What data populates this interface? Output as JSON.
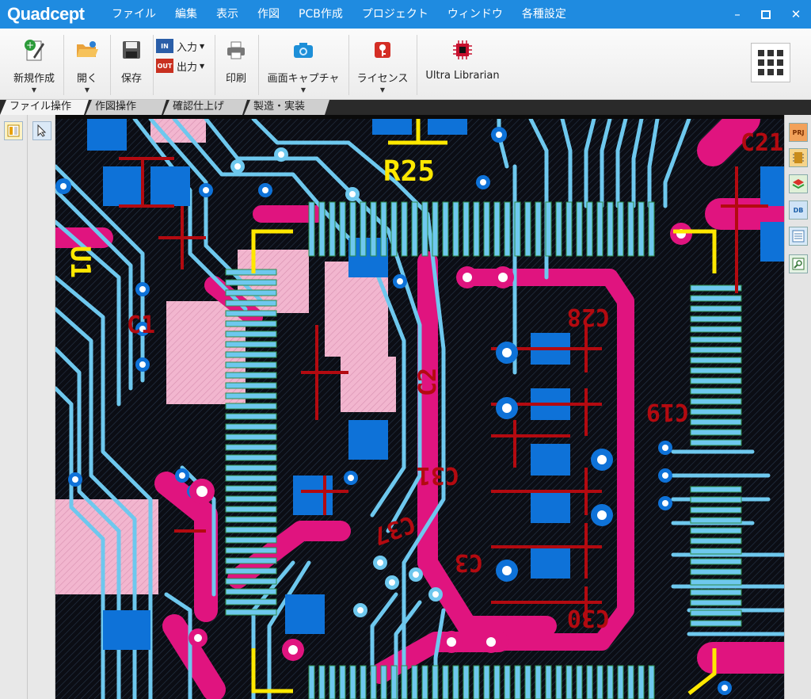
{
  "app": {
    "logo": "Quadcept"
  },
  "menu": [
    "ファイル",
    "編集",
    "表示",
    "作図",
    "PCB作成",
    "プロジェクト",
    "ウィンドウ",
    "各種設定"
  ],
  "window_controls": {
    "minimize": "–",
    "maximize": "□",
    "close": "✕"
  },
  "ribbon": {
    "new": "新規作成",
    "open": "開く",
    "save": "保存",
    "input": "入力",
    "output": "出力",
    "print": "印刷",
    "capture": "画面キャプチャ",
    "license": "ライセンス",
    "ultra": "Ultra Librarian",
    "input_badge": "IN",
    "output_badge": "OUT"
  },
  "tabs": [
    "ファイル操作",
    "作図操作",
    "確認仕上げ",
    "製造・実装"
  ],
  "right_panel": {
    "prj": "PRJ",
    "db": "DB"
  },
  "pcb": {
    "ref_r25": "R25",
    "ref_c21": "C21",
    "ref_c28": "C28",
    "ref_c19": "C19",
    "ref_c31": "C31",
    "ref_c37": "C37",
    "ref_c30": "C30",
    "ref_c3x": "C3",
    "ref_c2x": "C2",
    "ref_u1": "U1",
    "ref_c1x": "C1",
    "colors": {
      "pink": "#e0147f",
      "lightpink": "#f2b6cf",
      "lightblue": "#6ec8ee",
      "blue": "#0e72d8",
      "darkred": "#b30a10",
      "yellow": "#ffe800",
      "bg": "#0b0d14"
    }
  }
}
